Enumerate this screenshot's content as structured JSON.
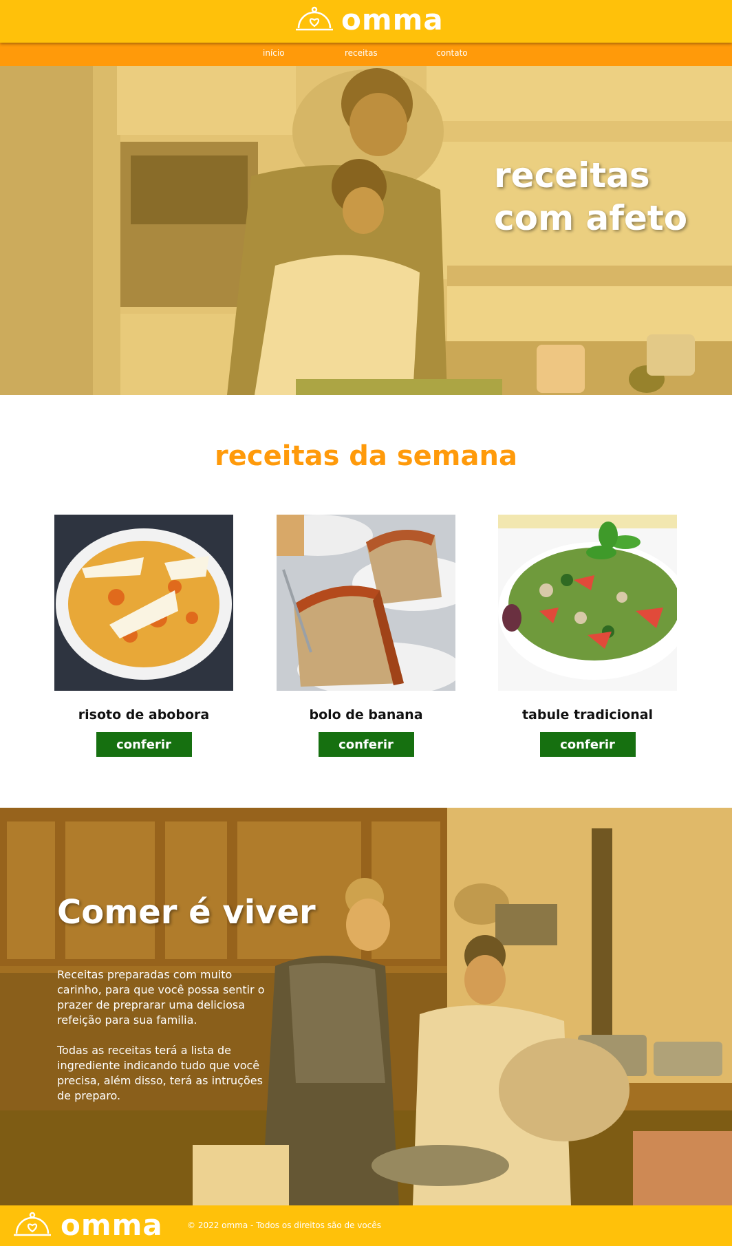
{
  "brand": {
    "name": "omma",
    "colors": {
      "header": "#ffc10a",
      "nav": "#ff9a0a",
      "accent": "#ff9a0a",
      "button": "#167010"
    },
    "logo_icon": "food-cloche-heart-icon"
  },
  "nav": {
    "items": [
      {
        "label": "início"
      },
      {
        "label": "receitas"
      },
      {
        "label": "contato"
      }
    ]
  },
  "hero": {
    "title_line1": "receitas",
    "title_line2": "com afeto",
    "image": "mother-and-daughter-cooking-photo"
  },
  "weekly": {
    "title": "receitas da semana",
    "cards": [
      {
        "name": "risoto de abobora",
        "button": "conferir",
        "image": "pumpkin-risotto-photo"
      },
      {
        "name": "bolo de banana",
        "button": "conferir",
        "image": "banana-cake-photo"
      },
      {
        "name": "tabule tradicional",
        "button": "conferir",
        "image": "tabbouleh-salad-photo"
      }
    ]
  },
  "about": {
    "title": "Comer é viver",
    "paragraph1": "Receitas preparadas com muito carinho, para que você possa sentir o prazer de preprarar uma deliciosa refeição para sua familia.",
    "paragraph2": "Todas as receitas terá a lista de ingrediente indicando tudo que você precisa, além disso, terá as intruções de preparo.",
    "image": "two-women-cooking-photo"
  },
  "footer": {
    "copyright": "© 2022 omma - Todos os direitos são de vocês"
  }
}
